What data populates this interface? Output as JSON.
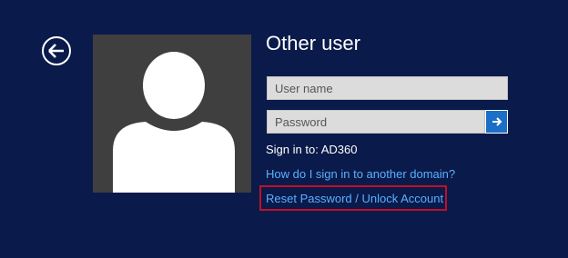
{
  "screen": {
    "title": "Other user",
    "username_placeholder": "User name",
    "password_placeholder": "Password",
    "signin_to": "Sign in to: AD360",
    "domain_link": "How do I sign in to another domain?",
    "reset_link": "Reset Password / Unlock Account"
  },
  "icons": {
    "back": "back-arrow-icon",
    "submit": "right-arrow-icon",
    "avatar": "user-silhouette-icon"
  },
  "colors": {
    "background": "#0a1a4a",
    "link": "#5ab0ff",
    "submit": "#1a6fc7",
    "highlight": "#c0102a"
  }
}
